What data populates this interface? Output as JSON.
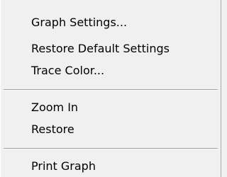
{
  "context_menu": {
    "groups": [
      {
        "items": [
          {
            "label": "Graph Settings..."
          },
          {
            "label": "Restore Default Settings"
          },
          {
            "label": "Trace Color..."
          }
        ]
      },
      {
        "items": [
          {
            "label": "Zoom In"
          },
          {
            "label": "Restore"
          }
        ]
      },
      {
        "items": [
          {
            "label": "Print Graph"
          }
        ]
      }
    ]
  }
}
